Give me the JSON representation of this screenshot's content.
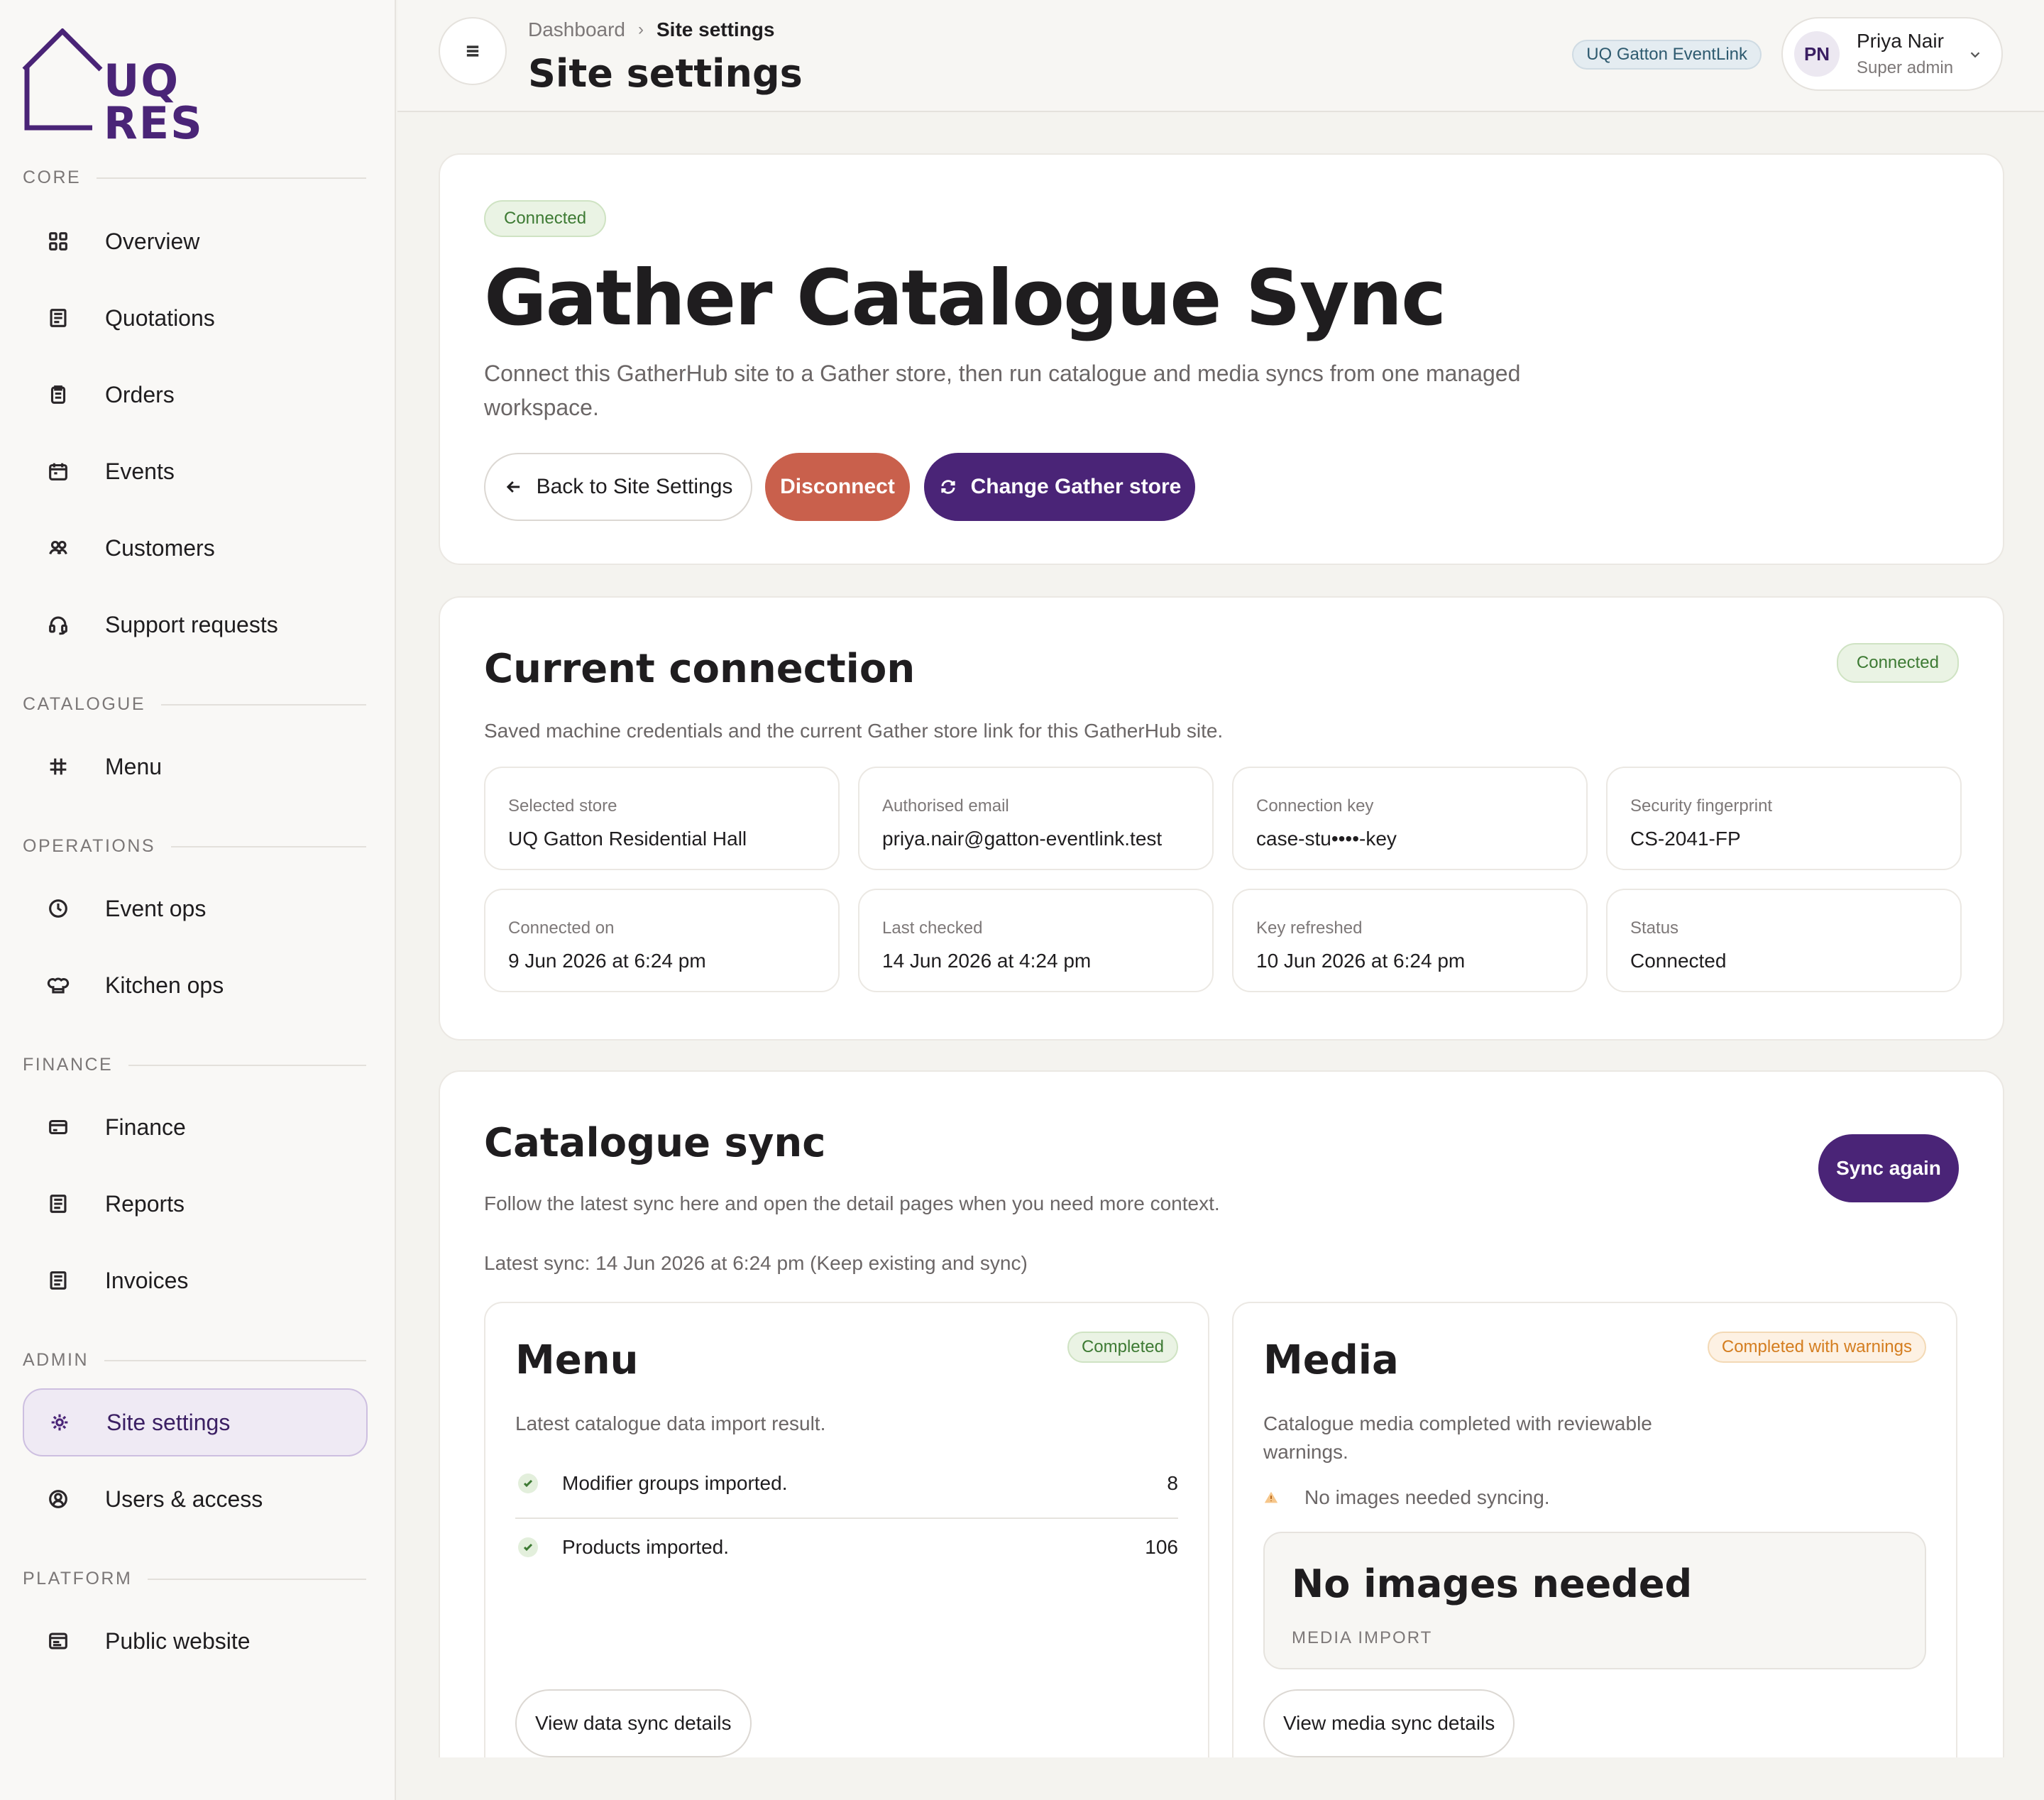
{
  "logo": {
    "line1": "UQ",
    "line2": "RES"
  },
  "sidebar": {
    "sections": [
      {
        "label": "CORE"
      },
      {
        "label": "CATALOGUE"
      },
      {
        "label": "OPERATIONS"
      },
      {
        "label": "FINANCE"
      },
      {
        "label": "ADMIN"
      },
      {
        "label": "PLATFORM"
      }
    ],
    "items": [
      {
        "label": "Overview",
        "icon": "grid-icon"
      },
      {
        "label": "Quotations",
        "icon": "document-icon"
      },
      {
        "label": "Orders",
        "icon": "clipboard-icon"
      },
      {
        "label": "Events",
        "icon": "calendar-icon"
      },
      {
        "label": "Customers",
        "icon": "users-icon"
      },
      {
        "label": "Support requests",
        "icon": "headset-icon"
      },
      {
        "label": "Menu",
        "icon": "hash-icon"
      },
      {
        "label": "Event ops",
        "icon": "clock-icon"
      },
      {
        "label": "Kitchen ops",
        "icon": "chef-hat-icon"
      },
      {
        "label": "Finance",
        "icon": "card-icon"
      },
      {
        "label": "Reports",
        "icon": "report-icon"
      },
      {
        "label": "Invoices",
        "icon": "invoice-icon"
      },
      {
        "label": "Site settings",
        "icon": "gear-icon"
      },
      {
        "label": "Users & access",
        "icon": "user-circle-icon"
      },
      {
        "label": "Public website",
        "icon": "browser-icon"
      }
    ]
  },
  "header": {
    "breadcrumb": {
      "parent": "Dashboard",
      "current": "Site settings"
    },
    "title": "Site settings",
    "site_pill": "UQ Gatton EventLink",
    "user": {
      "initials": "PN",
      "name": "Priya Nair",
      "role": "Super admin"
    }
  },
  "hero": {
    "badge": "Connected",
    "title": "Gather Catalogue Sync",
    "description": "Connect this GatherHub site to a Gather store, then run catalogue and media syncs from one managed workspace.",
    "buttons": {
      "back": "Back to Site Settings",
      "disconnect": "Disconnect",
      "change": "Change Gather store"
    }
  },
  "connection": {
    "title": "Current connection",
    "badge": "Connected",
    "description": "Saved machine credentials and the current Gather store link for this GatherHub site.",
    "fields": [
      {
        "label": "Selected store",
        "value": "UQ Gatton Residential Hall"
      },
      {
        "label": "Authorised email",
        "value": "priya.nair@gatton-eventlink.test"
      },
      {
        "label": "Connection key",
        "value": "case-stu••••-key"
      },
      {
        "label": "Security fingerprint",
        "value": "CS-2041-FP"
      },
      {
        "label": "Connected on",
        "value": "9 Jun 2026 at 6:24 pm"
      },
      {
        "label": "Last checked",
        "value": "14 Jun 2026 at 4:24 pm"
      },
      {
        "label": "Key refreshed",
        "value": "10 Jun 2026 at 6:24 pm"
      },
      {
        "label": "Status",
        "value": "Connected"
      }
    ]
  },
  "catalogue": {
    "title": "Catalogue sync",
    "description": "Follow the latest sync here and open the detail pages when you need more context.",
    "latest": "Latest sync: 14 Jun 2026 at 6:24 pm (Keep existing and sync)",
    "sync_button": "Sync again",
    "menu": {
      "title": "Menu",
      "badge": "Completed",
      "description": "Latest catalogue data import result.",
      "rows": [
        {
          "label": "Modifier groups imported.",
          "value": "8"
        },
        {
          "label": "Products imported.",
          "value": "106"
        }
      ],
      "button": "View data sync details"
    },
    "media": {
      "title": "Media",
      "badge": "Completed with warnings",
      "description": "Catalogue media completed with reviewable warnings.",
      "warning": "No images needed syncing.",
      "empty_title": "No images needed",
      "empty_sub": "MEDIA IMPORT",
      "button": "View media sync details"
    }
  },
  "colors": {
    "brand": "#4a2477",
    "danger": "#c9604c",
    "success": "#3d7a33",
    "warning": "#d47d1f"
  }
}
